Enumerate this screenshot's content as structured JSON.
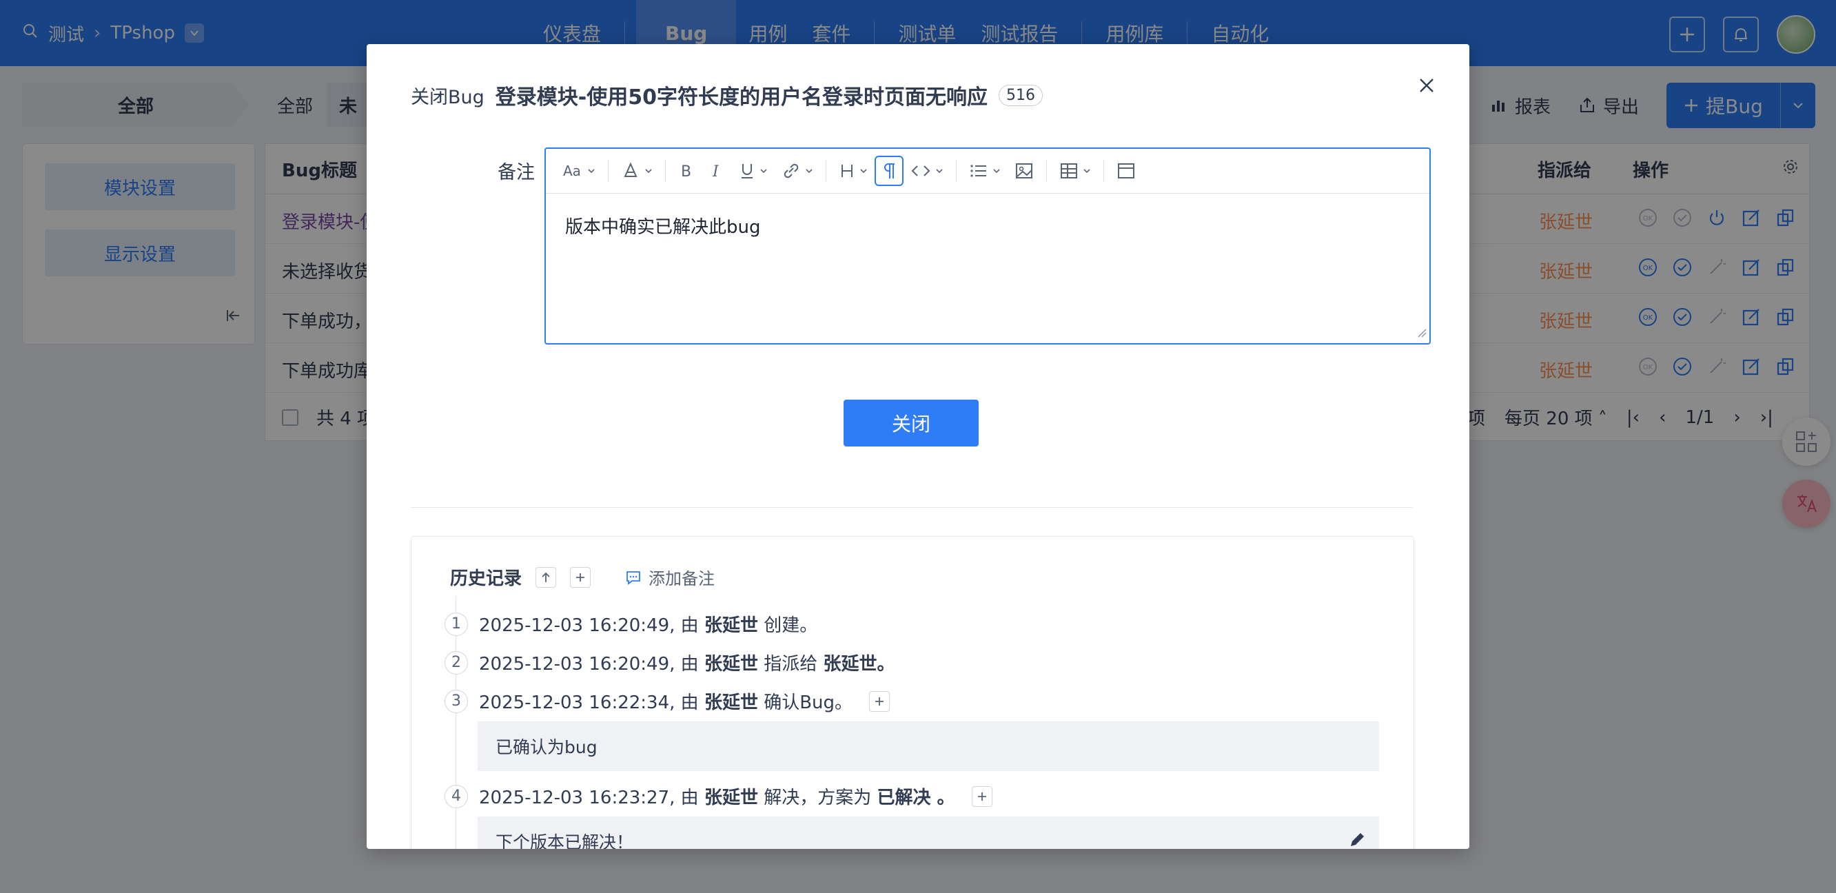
{
  "topbar": {
    "breadcrumb": [
      "测试",
      "TPshop"
    ],
    "nav": [
      "仪表盘",
      "Bug",
      "用例",
      "套件",
      "测试单",
      "测试报告",
      "用例库",
      "自动化"
    ],
    "active_nav": "Bug"
  },
  "subbar": {
    "all_chip": "全部",
    "tab_all": "全部",
    "tab_unclosed": "未",
    "report": "报表",
    "export": "导出",
    "submit_bug": "提Bug"
  },
  "sidebar": {
    "module_settings": "模块设置",
    "display_settings": "显示设置"
  },
  "table": {
    "col_title": "Bug标题",
    "col_assigned": "指派给",
    "col_actions": "操作",
    "rows": [
      {
        "title": "登录模块-使",
        "assigned": "张延世"
      },
      {
        "title": "未选择收货",
        "assigned": "张延世"
      },
      {
        "title": "下单成功，",
        "assigned": "张延世"
      },
      {
        "title": "下单成功库",
        "assigned": "张延世"
      }
    ],
    "footer_total": "共 4 项",
    "footer_page_size_suffix": "项",
    "per_page": "每页 20 项",
    "page": "1/1"
  },
  "modal": {
    "type_label": "关闭Bug",
    "title": "登录模块-使用50字符长度的用户名登录时页面无响应",
    "id": "516",
    "remark_label": "备注",
    "remark_text": "版本中确实已解决此bug",
    "close_button": "关闭",
    "history": {
      "title": "历史记录",
      "add_note": "添加备注",
      "entries": [
        {
          "num": "1",
          "time": "2025-12-03 16:20:49, 由",
          "user": "张延世",
          "action": "创建。"
        },
        {
          "num": "2",
          "time": "2025-12-03 16:20:49, 由",
          "user": "张延世",
          "action": "指派给",
          "target": "张延世。"
        },
        {
          "num": "3",
          "time": "2025-12-03 16:22:34, 由",
          "user": "张延世",
          "action": "确认Bug。",
          "comment": "已确认为bug"
        },
        {
          "num": "4",
          "time": "2025-12-03 16:23:27, 由",
          "user": "张延世",
          "action": "解决，方案为",
          "target": "已解决 。",
          "comment": "下个版本已解决！"
        }
      ]
    }
  },
  "colors": {
    "primary": "#2e7cf6",
    "assignee": "#ff9153",
    "overlay": "rgba(0,0,0,.46)"
  }
}
